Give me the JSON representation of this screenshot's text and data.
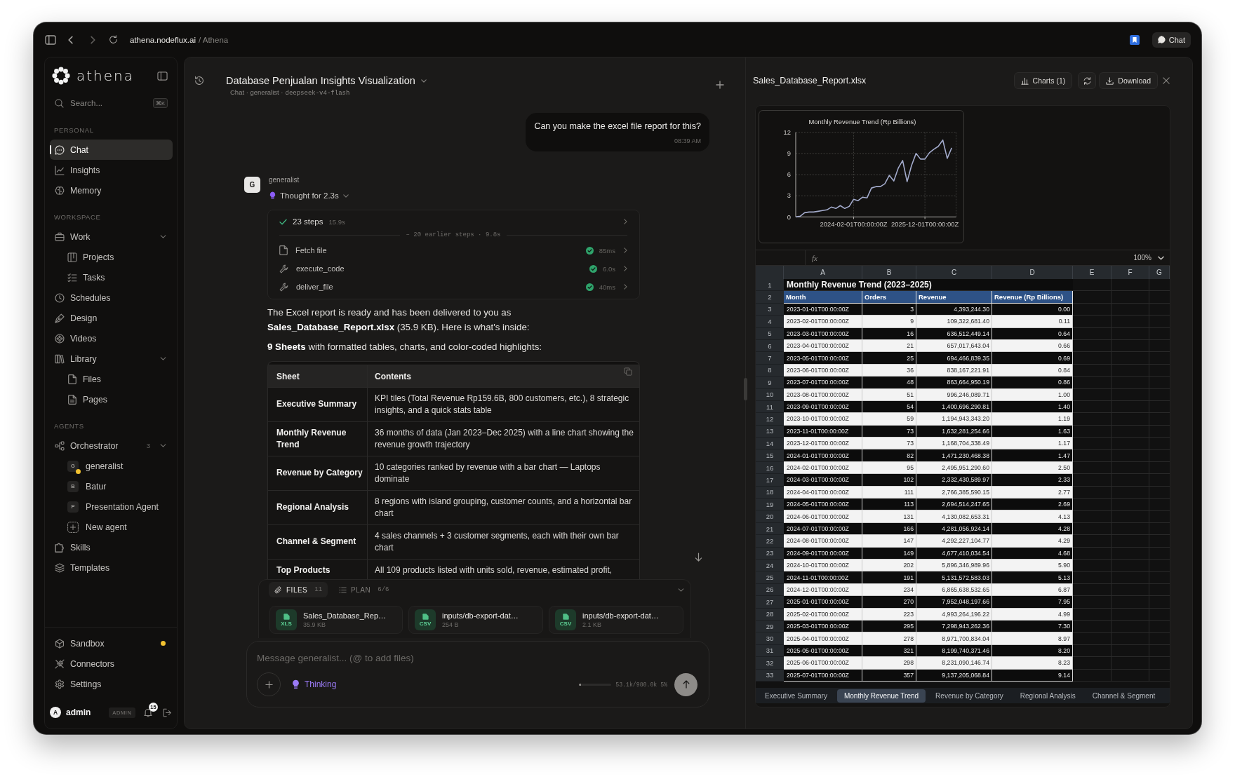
{
  "browser": {
    "host": "athena.nodeflux.ai",
    "path": "/ Athena",
    "chat_button": "Chat"
  },
  "sidebar": {
    "brand": "athena",
    "search": {
      "placeholder": "Search...",
      "shortcut": "⌘K"
    },
    "sections": [
      {
        "label": "PERSONAL",
        "items": [
          {
            "label": "Chat",
            "selected": true
          },
          {
            "label": "Insights",
            "selected": false
          },
          {
            "label": "Memory",
            "selected": false
          }
        ]
      },
      {
        "label": "WORKSPACE",
        "items": [
          {
            "label": "Work",
            "selected": false,
            "expanded": true,
            "children": [
              {
                "label": "Projects",
                "selected": false
              },
              {
                "label": "Tasks",
                "selected": false
              }
            ]
          },
          {
            "label": "Schedules",
            "selected": false
          },
          {
            "label": "Design",
            "selected": false
          },
          {
            "label": "Videos",
            "selected": false
          },
          {
            "label": "Library",
            "selected": false,
            "expanded": true,
            "children": [
              {
                "label": "Files",
                "selected": false
              },
              {
                "label": "Pages",
                "selected": false
              }
            ]
          }
        ]
      },
      {
        "label": "AGENTS",
        "items": [
          {
            "label": "Orchestrator",
            "selected": false,
            "count": "3",
            "expanded": true,
            "children": [
              {
                "kind": "agent",
                "initial": "G",
                "label": "generalist",
                "selected": false,
                "active": true
              },
              {
                "kind": "agent",
                "initial": "B",
                "label": "Batur",
                "selected": false,
                "active": false
              },
              {
                "kind": "agent",
                "initial": "P",
                "label": "Presentation Agent",
                "selected": false,
                "active": false
              },
              {
                "kind": "action",
                "label": "New agent",
                "selected": false
              }
            ]
          },
          {
            "label": "Skills",
            "selected": false
          },
          {
            "label": "Templates",
            "selected": false
          }
        ]
      }
    ],
    "footer_items": [
      {
        "label": "Sandbox",
        "selected": false,
        "status_dot": true
      },
      {
        "label": "Connectors",
        "selected": false,
        "status_dot": false
      },
      {
        "label": "Settings",
        "selected": false,
        "status_dot": false
      }
    ],
    "user": {
      "avatar": "A",
      "name": "admin",
      "role": "ADMIN",
      "notifications": "15"
    }
  },
  "chat": {
    "title": "Database Penjualan Insights Visualization",
    "subtitle": "Chat · generalist ·",
    "model": "deepseek-v4-flash",
    "messages": [
      {
        "kind": "user",
        "text": "Can you make the excel file report for this?",
        "time": "08:39 AM"
      },
      {
        "kind": "agent",
        "avatar": "G",
        "author": "generalist",
        "thought": "Thought for 2.3s",
        "steps": {
          "summary": "23 steps",
          "duration": "15.9s",
          "done": true,
          "earlier": "– 20 earlier steps · 9.8s",
          "items": [
            {
              "kind": "file",
              "name": "Fetch file",
              "duration": "85ms",
              "done": true
            },
            {
              "kind": "tool",
              "name": "execute_code",
              "duration": "6.0s",
              "done": true
            },
            {
              "kind": "tool",
              "name": "deliver_file",
              "duration": "40ms",
              "done": true
            }
          ]
        },
        "paragraphs": [
          "The Excel report is ready and has been delivered to you as **Sales_Database_Report.xlsx** (35.9 KB). Here is what's inside:",
          "**9 Sheets** with formatted tables, charts, and color-coded highlights:"
        ],
        "table": {
          "columns": [
            "Sheet",
            "Contents"
          ],
          "rows": [
            {
              "sheet": "Executive Summary",
              "contents": "KPI tiles (Total Revenue Rp159.6B, 800 customers, etc.), 8 strategic insights, and a quick stats table"
            },
            {
              "sheet": "Monthly Revenue Trend",
              "contents": "36 months of data (Jan 2023–Dec 2025) with a line chart showing the revenue growth trajectory"
            },
            {
              "sheet": "Revenue by Category",
              "contents": "10 categories ranked by revenue with a bar chart — Laptops dominate"
            },
            {
              "sheet": "Regional Analysis",
              "contents": "8 regions with island grouping, customer counts, and a horizontal bar chart"
            },
            {
              "sheet": "Channel & Segment",
              "contents": "4 sales channels + 3 customer segments, each with their own bar chart"
            },
            {
              "sheet": "Top Products",
              "contents": "All 109 products listed with units sold, revenue, estimated profit,"
            }
          ]
        }
      }
    ],
    "files_panel": {
      "tabs": [
        {
          "label": "FILES",
          "count": "11",
          "selected": true
        },
        {
          "label": "PLAN",
          "count": "6/6",
          "selected": false
        }
      ],
      "files": [
        {
          "name": "Sales_Database_Rep…",
          "size": "35.9 KB",
          "type": "XLS"
        },
        {
          "name": "inputs/db-export-dat…",
          "size": "254 B",
          "type": "CSV"
        },
        {
          "name": "inputs/db-export-dat…",
          "size": "2.1 KB",
          "type": "CSV"
        }
      ]
    },
    "composer": {
      "placeholder": "Message generalist... (@ to add files)",
      "mode": {
        "label": "Thinking",
        "on": true
      },
      "context": {
        "level": 0.05,
        "text": "53.1k/980.0k 5%"
      }
    }
  },
  "viewer": {
    "filename": "Sales_Database_Report.xlsx",
    "actions": [
      {
        "kind": "charts",
        "label": "Charts (1)"
      },
      {
        "kind": "refresh"
      },
      {
        "kind": "download",
        "label": "Download"
      },
      {
        "kind": "close"
      }
    ],
    "chart_data": {
      "type": "line",
      "title": "Monthly Revenue Trend (Rp Billions)",
      "categories": [
        null,
        null,
        null,
        null,
        null,
        null,
        null,
        null,
        null,
        null,
        null,
        null,
        null,
        "2024-02-01T00:00:00Z",
        null,
        null,
        null,
        null,
        null,
        null,
        null,
        null,
        null,
        null,
        null,
        null,
        null,
        null,
        null,
        "2025-12-01T00:00:00Z",
        null,
        null,
        null,
        null,
        null,
        null
      ],
      "series": [
        {
          "color": "#a3abcc",
          "values": [
            0.0,
            0.1,
            0.6,
            0.7,
            0.7,
            0.8,
            0.9,
            1.0,
            1.4,
            1.2,
            1.6,
            1.2,
            1.5,
            2.5,
            2.3,
            2.8,
            2.7,
            4.1,
            4.3,
            4.3,
            4.7,
            5.9,
            5.1,
            6.9,
            8.0,
            5.0,
            7.3,
            9.0,
            8.2,
            8.2,
            9.1,
            9.6,
            10.0,
            10.9,
            8.3,
            9.8
          ]
        }
      ],
      "ylim": [
        0,
        12
      ],
      "yticks": [
        0,
        3,
        6,
        9,
        12
      ],
      "grid": true
    },
    "spreadsheet": {
      "formula_bar": {
        "function_label": "fx",
        "zoom": "100%"
      },
      "columns": [
        "A",
        "B",
        "C",
        "D",
        "E",
        "F",
        "G"
      ],
      "title_row": {
        "number": "1",
        "title": "Monthly Revenue Trend (2023–2025)"
      },
      "header_row": {
        "number": "2",
        "cells": [
          "Month",
          "Orders",
          "Revenue",
          "Revenue (Rp Billions)"
        ]
      },
      "striped": true,
      "rows": [
        {
          "number": "3",
          "cells": [
            "2023-01-01T00:00:00Z",
            "3",
            "4,393,244.30",
            "0.00"
          ]
        },
        {
          "number": "4",
          "cells": [
            "2023-02-01T00:00:00Z",
            "9",
            "109,322,681.40",
            "0.11"
          ]
        },
        {
          "number": "5",
          "cells": [
            "2023-03-01T00:00:00Z",
            "16",
            "636,512,449.14",
            "0.64"
          ]
        },
        {
          "number": "6",
          "cells": [
            "2023-04-01T00:00:00Z",
            "21",
            "657,017,643.04",
            "0.66"
          ]
        },
        {
          "number": "7",
          "cells": [
            "2023-05-01T00:00:00Z",
            "25",
            "694,466,839.35",
            "0.69"
          ]
        },
        {
          "number": "8",
          "cells": [
            "2023-06-01T00:00:00Z",
            "36",
            "838,167,221.91",
            "0.84"
          ]
        },
        {
          "number": "9",
          "cells": [
            "2023-07-01T00:00:00Z",
            "48",
            "863,664,950.19",
            "0.86"
          ]
        },
        {
          "number": "10",
          "cells": [
            "2023-08-01T00:00:00Z",
            "51",
            "996,246,089.71",
            "1.00"
          ]
        },
        {
          "number": "11",
          "cells": [
            "2023-09-01T00:00:00Z",
            "54",
            "1,400,696,290.81",
            "1.40"
          ]
        },
        {
          "number": "12",
          "cells": [
            "2023-10-01T00:00:00Z",
            "59",
            "1,194,943,343.20",
            "1.19"
          ]
        },
        {
          "number": "13",
          "cells": [
            "2023-11-01T00:00:00Z",
            "73",
            "1,632,281,254.66",
            "1.63"
          ]
        },
        {
          "number": "14",
          "cells": [
            "2023-12-01T00:00:00Z",
            "73",
            "1,168,704,338.49",
            "1.17"
          ]
        },
        {
          "number": "15",
          "cells": [
            "2024-01-01T00:00:00Z",
            "82",
            "1,471,230,468.38",
            "1.47"
          ]
        },
        {
          "number": "16",
          "cells": [
            "2024-02-01T00:00:00Z",
            "95",
            "2,495,951,290.60",
            "2.50"
          ]
        },
        {
          "number": "17",
          "cells": [
            "2024-03-01T00:00:00Z",
            "102",
            "2,332,430,589.97",
            "2.33"
          ]
        },
        {
          "number": "18",
          "cells": [
            "2024-04-01T00:00:00Z",
            "111",
            "2,766,385,590.15",
            "2.77"
          ]
        },
        {
          "number": "19",
          "cells": [
            "2024-05-01T00:00:00Z",
            "113",
            "2,694,514,247.65",
            "2.69"
          ]
        },
        {
          "number": "20",
          "cells": [
            "2024-06-01T00:00:00Z",
            "131",
            "4,130,082,653.31",
            "4.13"
          ]
        },
        {
          "number": "21",
          "cells": [
            "2024-07-01T00:00:00Z",
            "166",
            "4,281,056,924.14",
            "4.28"
          ]
        },
        {
          "number": "22",
          "cells": [
            "2024-08-01T00:00:00Z",
            "147",
            "4,292,227,104.77",
            "4.29"
          ]
        },
        {
          "number": "23",
          "cells": [
            "2024-09-01T00:00:00Z",
            "149",
            "4,677,410,034.54",
            "4.68"
          ]
        },
        {
          "number": "24",
          "cells": [
            "2024-10-01T00:00:00Z",
            "202",
            "5,896,346,989.96",
            "5.90"
          ]
        },
        {
          "number": "25",
          "cells": [
            "2024-11-01T00:00:00Z",
            "191",
            "5,131,572,583.03",
            "5.13"
          ]
        },
        {
          "number": "26",
          "cells": [
            "2024-12-01T00:00:00Z",
            "234",
            "6,865,638,532.65",
            "6.87"
          ]
        },
        {
          "number": "27",
          "cells": [
            "2025-01-01T00:00:00Z",
            "270",
            "7,952,048,197.66",
            "7.95"
          ]
        },
        {
          "number": "28",
          "cells": [
            "2025-02-01T00:00:00Z",
            "223",
            "4,993,264,196.22",
            "4.99"
          ]
        },
        {
          "number": "29",
          "cells": [
            "2025-03-01T00:00:00Z",
            "295",
            "7,298,943,262.36",
            "7.30"
          ]
        },
        {
          "number": "30",
          "cells": [
            "2025-04-01T00:00:00Z",
            "278",
            "8,971,700,834.04",
            "8.97"
          ]
        },
        {
          "number": "31",
          "cells": [
            "2025-05-01T00:00:00Z",
            "321",
            "8,199,740,371.46",
            "8.20"
          ]
        },
        {
          "number": "32",
          "cells": [
            "2025-06-01T00:00:00Z",
            "298",
            "8,231,090,146.74",
            "8.23"
          ]
        },
        {
          "number": "33",
          "cells": [
            "2025-07-01T00:00:00Z",
            "357",
            "9,137,205,068.84",
            "9.14"
          ]
        }
      ],
      "sheet_tabs": [
        {
          "label": "Executive Summary",
          "selected": false
        },
        {
          "label": "Monthly Revenue Trend",
          "selected": true
        },
        {
          "label": "Revenue by Category",
          "selected": false
        },
        {
          "label": "Regional Analysis",
          "selected": false
        },
        {
          "label": "Channel & Segment",
          "selected": false
        }
      ]
    }
  }
}
